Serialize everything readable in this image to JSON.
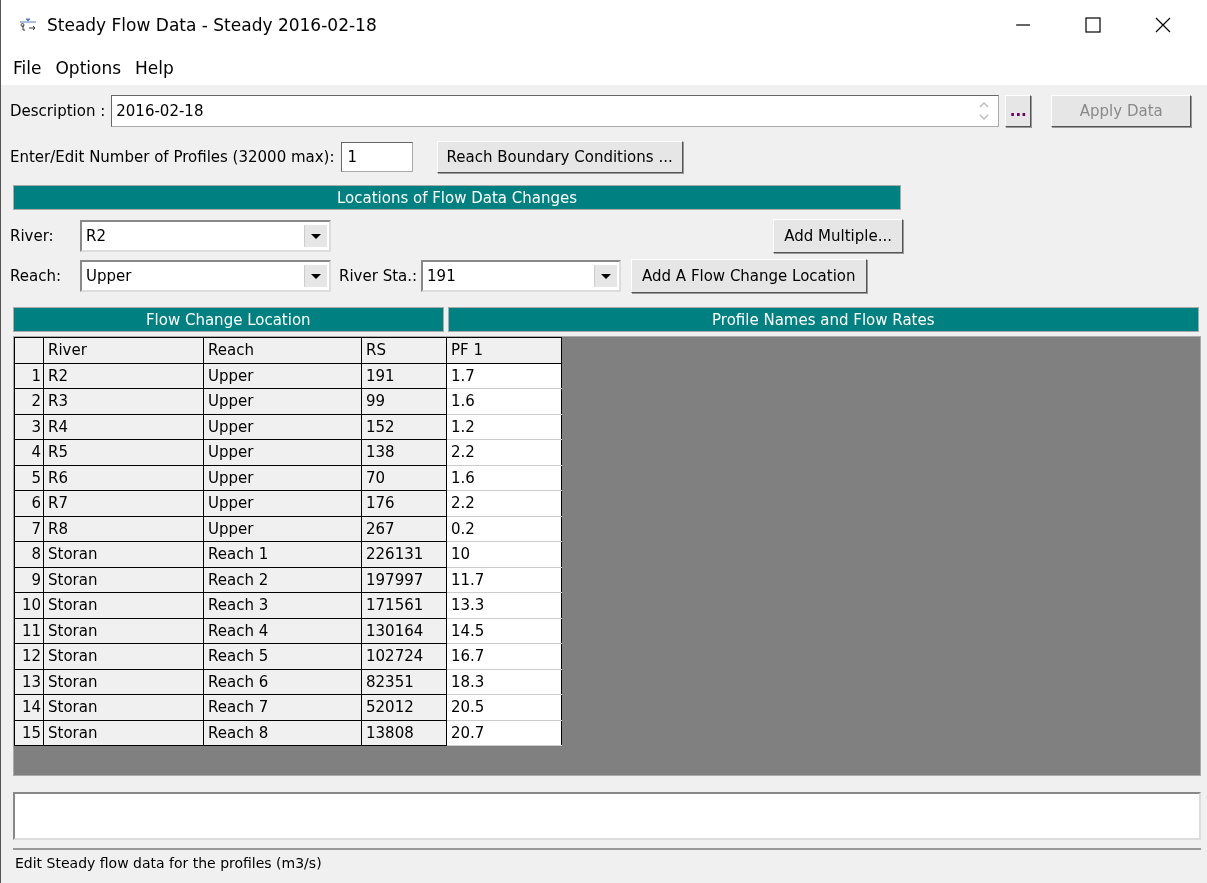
{
  "window": {
    "title": "Steady Flow Data - Steady 2016-02-18"
  },
  "menu": [
    "File",
    "Options",
    "Help"
  ],
  "description": {
    "label": "Description :",
    "value": "2016-02-18"
  },
  "more_button": "...",
  "apply_button": {
    "label": "Apply Data",
    "disabled": true
  },
  "profiles": {
    "label": "Enter/Edit Number of Profiles (32000 max):",
    "value": "1"
  },
  "reach_boundary_button": "Reach Boundary Conditions ...",
  "locations": {
    "title": "Locations of Flow Data Changes",
    "river": {
      "label": "River:",
      "value": "R2"
    },
    "reach": {
      "label": "Reach:",
      "value": "Upper"
    },
    "river_sta": {
      "label": "River Sta.:",
      "value": "191"
    },
    "add_multiple_button": "Add Multiple...",
    "add_location_button": "Add A Flow Change Location"
  },
  "table": {
    "left_title": "Flow Change Location",
    "right_title": "Profile Names and Flow Rates",
    "columns": [
      "River",
      "Reach",
      "RS",
      "PF 1"
    ],
    "rows": [
      {
        "index": "1",
        "river": "R2",
        "reach": "Upper",
        "rs": "191",
        "pf_1": "1.7"
      },
      {
        "index": "2",
        "river": "R3",
        "reach": "Upper",
        "rs": "99",
        "pf_1": "1.6"
      },
      {
        "index": "3",
        "river": "R4",
        "reach": "Upper",
        "rs": "152",
        "pf_1": "1.2"
      },
      {
        "index": "4",
        "river": "R5",
        "reach": "Upper",
        "rs": "138",
        "pf_1": "2.2"
      },
      {
        "index": "5",
        "river": "R6",
        "reach": "Upper",
        "rs": "70",
        "pf_1": "1.6"
      },
      {
        "index": "6",
        "river": "R7",
        "reach": "Upper",
        "rs": "176",
        "pf_1": "2.2"
      },
      {
        "index": "7",
        "river": "R8",
        "reach": "Upper",
        "rs": "267",
        "pf_1": "0.2"
      },
      {
        "index": "8",
        "river": "Storan",
        "reach": "Reach 1",
        "rs": "226131",
        "pf_1": "10"
      },
      {
        "index": "9",
        "river": "Storan",
        "reach": "Reach 2",
        "rs": "197997",
        "pf_1": "11.7"
      },
      {
        "index": "10",
        "river": "Storan",
        "reach": "Reach 3",
        "rs": "171561",
        "pf_1": "13.3"
      },
      {
        "index": "11",
        "river": "Storan",
        "reach": "Reach 4",
        "rs": "130164",
        "pf_1": "14.5"
      },
      {
        "index": "12",
        "river": "Storan",
        "reach": "Reach 5",
        "rs": "102724",
        "pf_1": "16.7"
      },
      {
        "index": "13",
        "river": "Storan",
        "reach": "Reach 6",
        "rs": "82351",
        "pf_1": "18.3"
      },
      {
        "index": "14",
        "river": "Storan",
        "reach": "Reach 7",
        "rs": "52012",
        "pf_1": "20.5"
      },
      {
        "index": "15",
        "river": "Storan",
        "reach": "Reach 8",
        "rs": "13808",
        "pf_1": "20.7"
      }
    ]
  },
  "status_bar": "Edit Steady flow data for the profiles (m3/s)"
}
